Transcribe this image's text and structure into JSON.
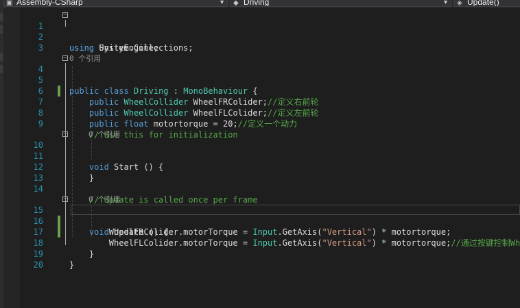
{
  "navbar": {
    "project": "Assembly-CSharp",
    "class": "Driving",
    "member": "Update()"
  },
  "editor": {
    "lines": [
      {
        "n": "1"
      },
      {
        "n": "2"
      },
      {
        "n": "3"
      },
      {
        "n": "4"
      },
      {
        "n": "5"
      },
      {
        "n": "6"
      },
      {
        "n": "7"
      },
      {
        "n": "8"
      },
      {
        "n": "9"
      },
      {
        "n": "10"
      },
      {
        "n": "11"
      },
      {
        "n": "12"
      },
      {
        "n": "13"
      },
      {
        "n": "14"
      },
      {
        "n": "15"
      },
      {
        "n": "16"
      },
      {
        "n": "17"
      },
      {
        "n": "18"
      },
      {
        "n": "19"
      },
      {
        "n": "20"
      }
    ],
    "code": {
      "l1_kw": "using",
      "l1_rest": " UnityEngine;",
      "l2_kw": "using",
      "l2_rest": " System.Collections;",
      "ref_label": "0 个引用",
      "l4_kw1": "public",
      "l4_kw2": "class",
      "l4_name": "Driving",
      "l4_sep": " : ",
      "l4_base": "MonoBehaviour",
      "l4_brace": " {",
      "l6_kw": "public",
      "l6_type": "WheelCollider",
      "l6_rest": " WheelFRColider;",
      "l6_cm": "//定义右前轮",
      "l7_kw": "public",
      "l7_type": "WheelCollider",
      "l7_rest": " WheelFLColider;",
      "l7_cm": "//定义左前轮",
      "l8_kw1": "public",
      "l8_kw2": "float",
      "l8_rest": " motortorque = 20;",
      "l8_cm": "//定义一个动力",
      "l9_cm": "// Use this for initialization",
      "l10_kw": "void",
      "l10_rest": " Start () {",
      "l12": "}",
      "l14_cm": "// Update is called once per frame",
      "l15_kw": "void",
      "l15_rest": " Update () {",
      "l16_a": "WheelFRColider.motorTorque = ",
      "l16_type": "Input",
      "l16_b": ".GetAxis(",
      "l16_str": "\"Vertical\"",
      "l16_c": ") * motortorque;",
      "l17_a": "WheelFLColider.motorTorque = ",
      "l17_type": "Input",
      "l17_b": ".GetAxis(",
      "l17_str": "\"Vertical\"",
      "l17_c": ") * motortorque;",
      "l17_cm": "//通过按键控制Whe",
      "l18": "}",
      "l19": "}"
    }
  },
  "colors": {
    "background": "#1e1e1e",
    "keyword": "#569cd6",
    "type": "#4ec9b0",
    "comment": "#57a64a",
    "string": "#d69d85",
    "line_number": "#2b91af",
    "changed_marker": "#6ca050"
  }
}
